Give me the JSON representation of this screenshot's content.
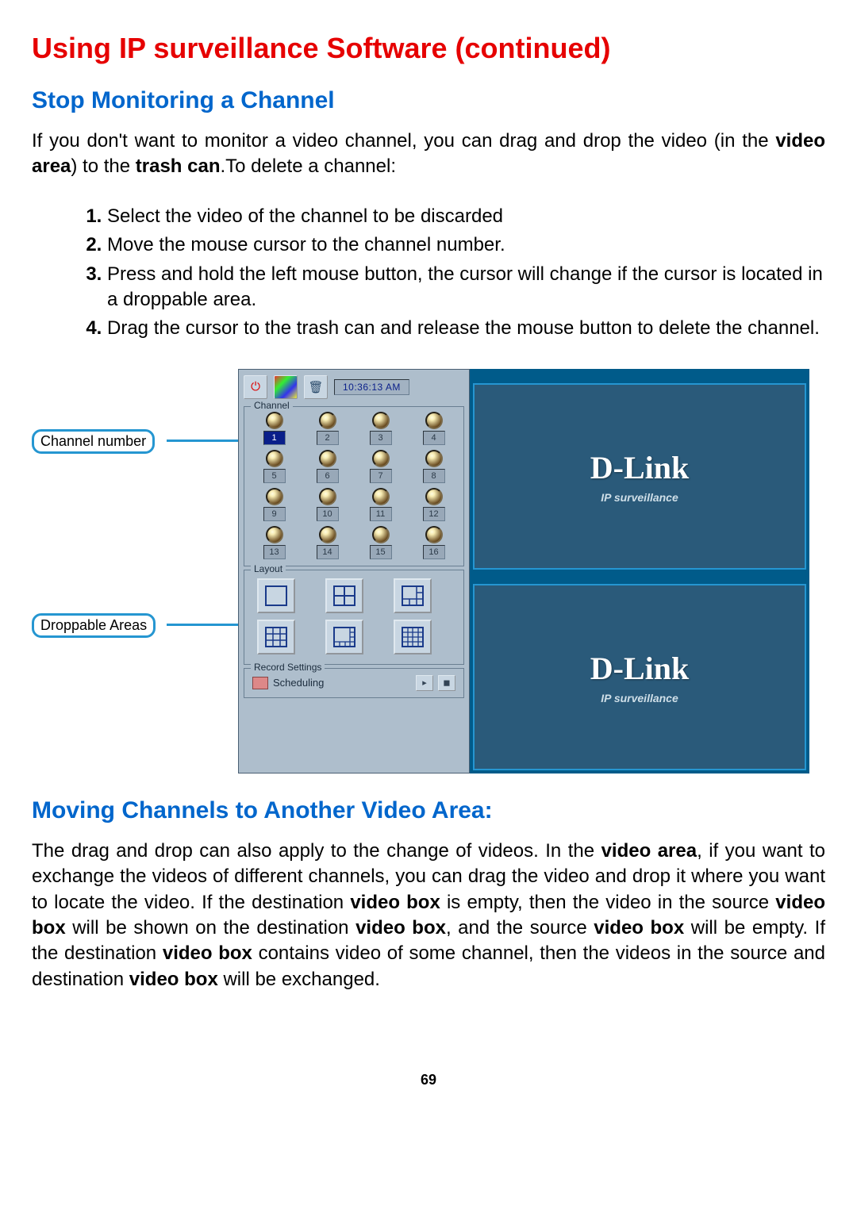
{
  "title": "Using IP surveillance Software (continued)",
  "h2a": "Stop Monitoring a Channel",
  "p1": "If you don't want to monitor a video channel, you can drag and drop the video (in the ",
  "p1b1": "video area",
  "p1c": ") to the ",
  "p1b2": "trash can",
  "p1d": ".To delete a channel:",
  "steps": [
    "Select the video of the channel to be discarded",
    "Move the mouse cursor to the channel number.",
    "Press and hold the left mouse button, the cursor will change if the cursor is located in a droppable area.",
    "Drag the cursor to the trash can and release the mouse button to delete the channel."
  ],
  "callout1": "Channel number",
  "callout2": "Droppable Areas",
  "toolbar": {
    "time": "10:36:13 AM"
  },
  "legends": {
    "channel": "Channel",
    "layout": "Layout",
    "record": "Record Settings"
  },
  "channels": [
    "1",
    "2",
    "3",
    "4",
    "5",
    "6",
    "7",
    "8",
    "9",
    "10",
    "11",
    "12",
    "13",
    "14",
    "15",
    "16"
  ],
  "scheduling": "Scheduling",
  "video_label": "IP surveillance",
  "brand": "D-Link",
  "brand_sub": "IP surveillance",
  "h2b": "Moving Channels to Another Video Area:",
  "p2": "The drag and drop can also apply to the change of videos. In the ",
  "p2b1": "video area",
  "p2c": ", if you want to exchange the videos of different channels, you can drag the video and drop it where you want to locate the video. If the destination ",
  "p2b2": "video box",
  "p2d": " is empty, then the video in the source ",
  "p2b3": "video box",
  "p2e": " will be shown on the destination ",
  "p2b4": "video box",
  "p2f": ", and the source ",
  "p2b5": "video box",
  "p2g": " will be empty. If the destination ",
  "p2b6": "video box",
  "p2h": " contains video of some channel, then the videos in the source and destination ",
  "p2b7": "video box",
  "p2i": " will be exchanged.",
  "pagenum": "69"
}
